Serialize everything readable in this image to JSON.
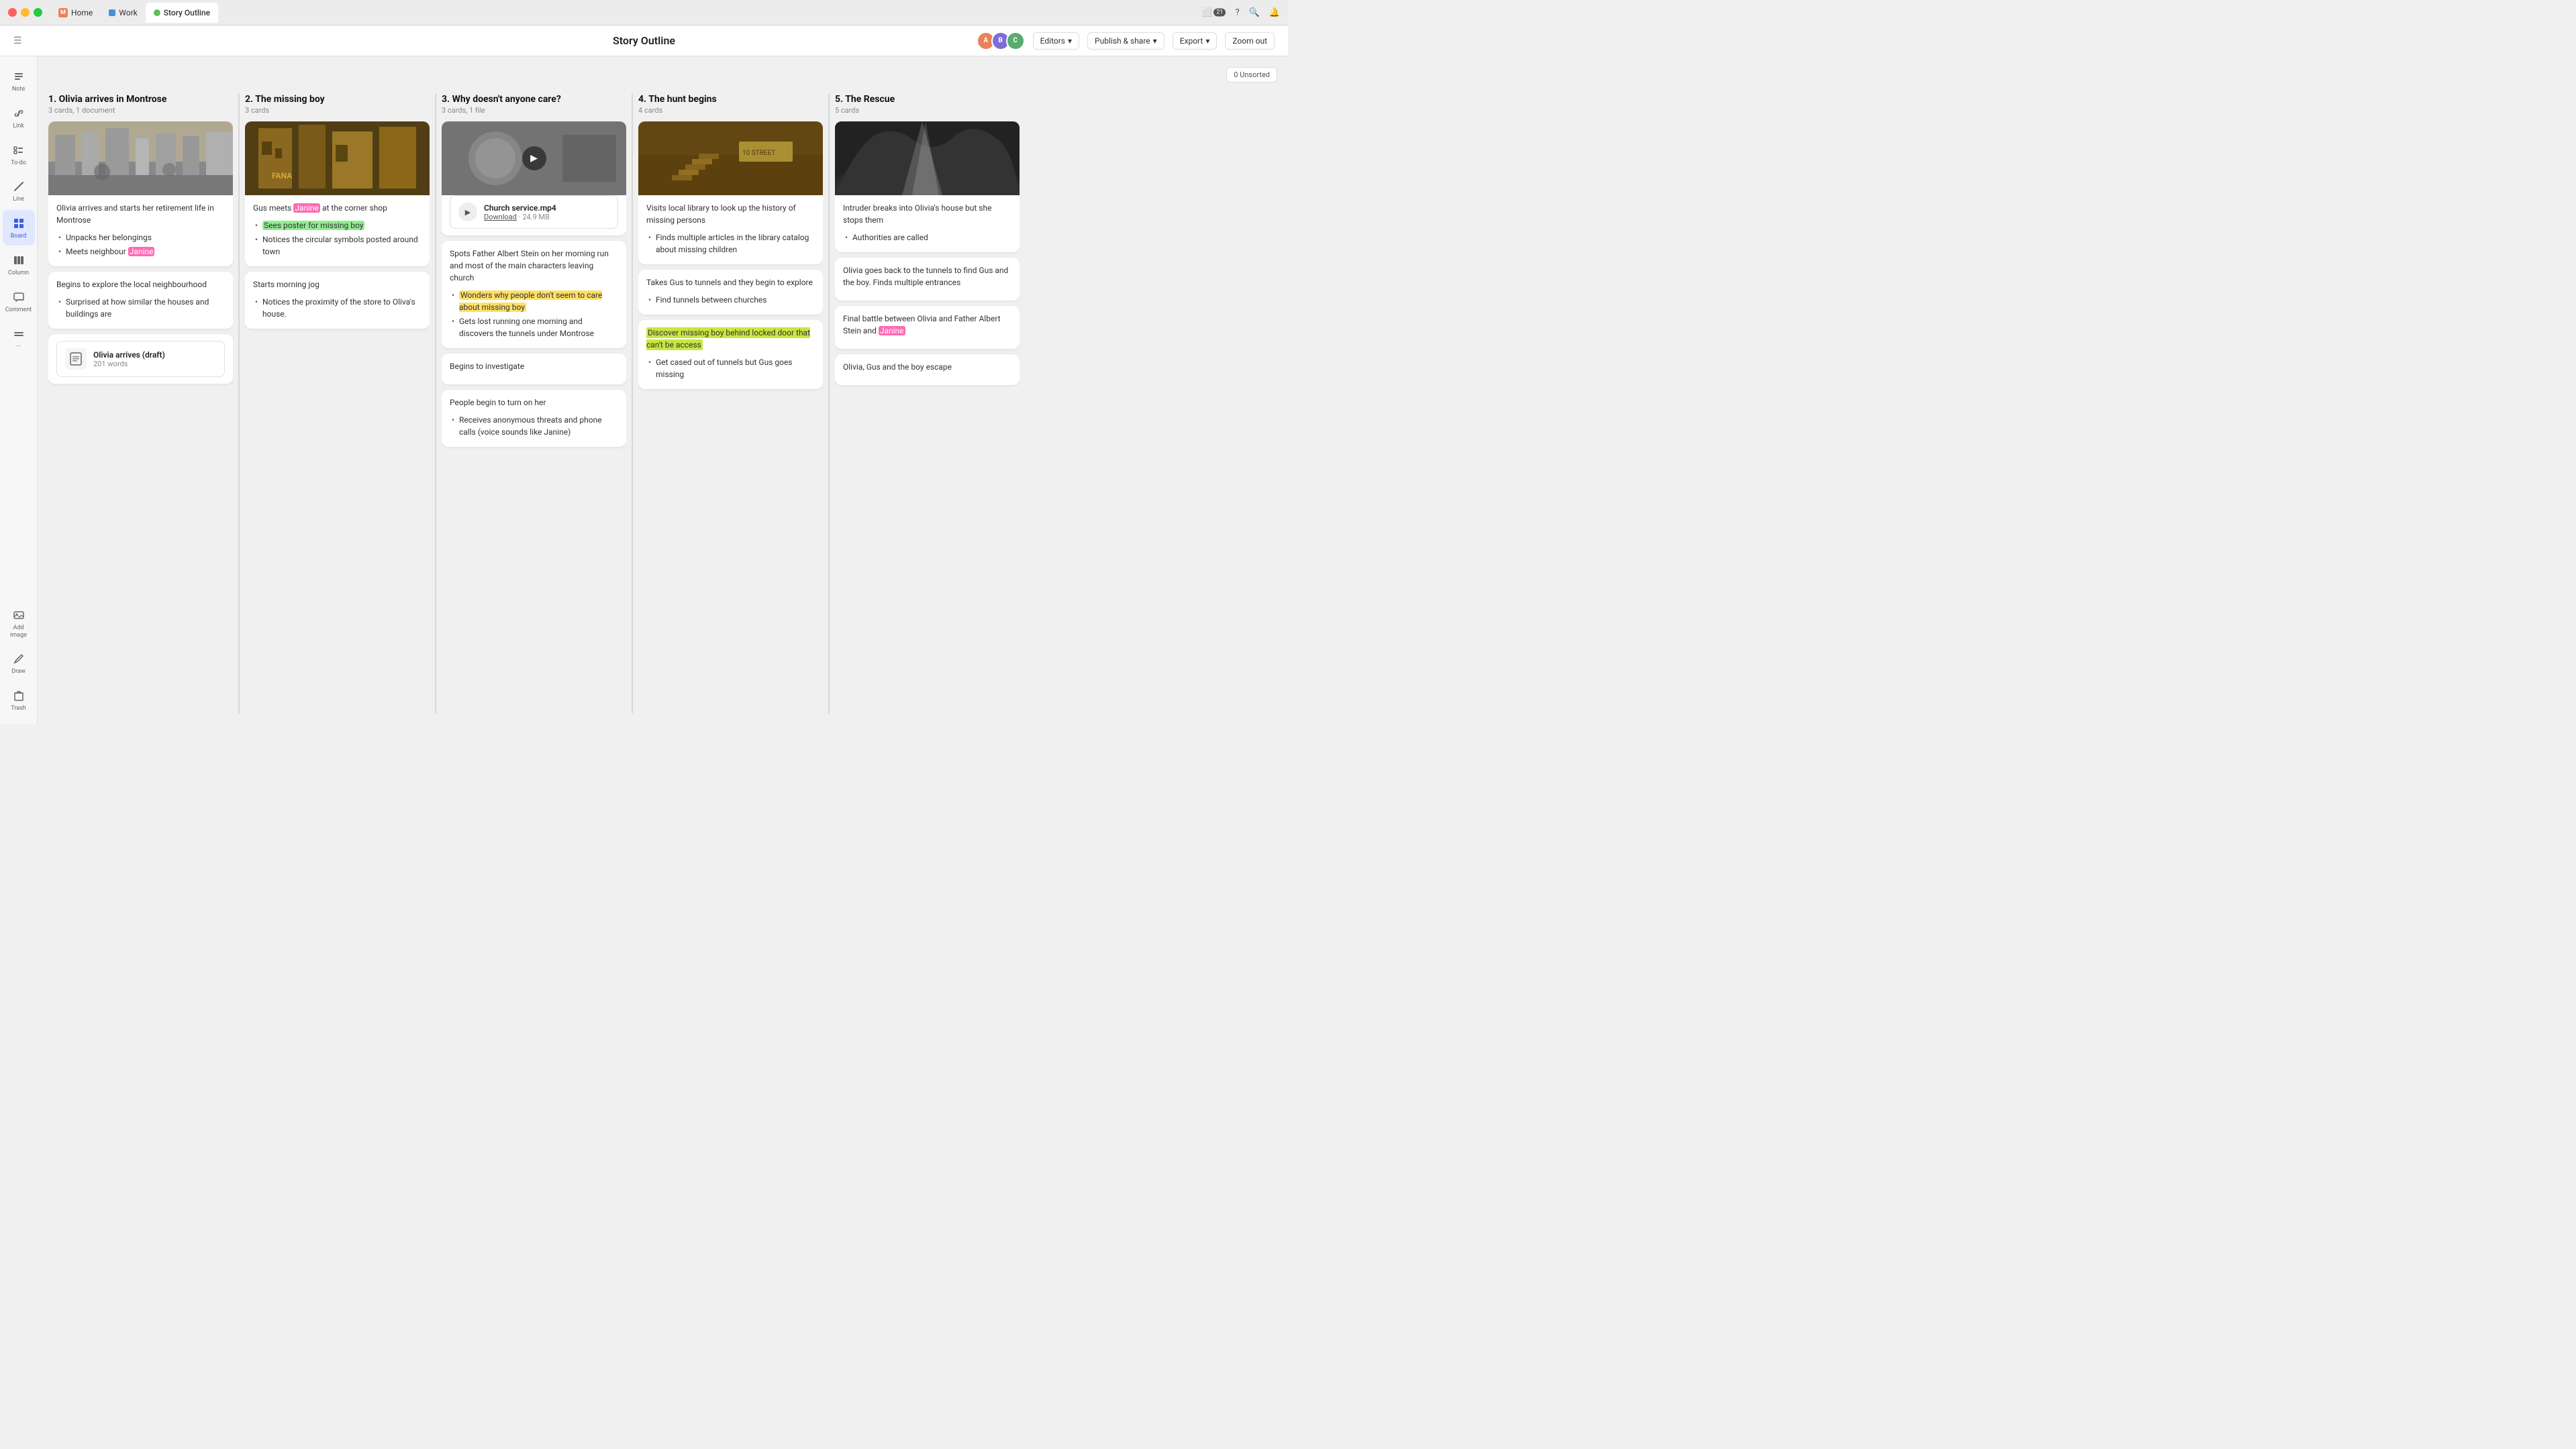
{
  "titlebar": {
    "tabs": [
      {
        "id": "home",
        "label": "Home",
        "icon": "M"
      },
      {
        "id": "work",
        "label": "Work",
        "icon": "W"
      },
      {
        "id": "story-outline",
        "label": "Story Outline",
        "active": true
      }
    ],
    "right_icons": [
      "monitor-icon",
      "help-icon",
      "search-icon",
      "bell-icon"
    ],
    "notif_count": "21"
  },
  "toolbar": {
    "title": "Story Outline",
    "avatars": [
      "A1",
      "A2",
      "A3"
    ],
    "editors_label": "Editors",
    "publish_label": "Publish & share",
    "export_label": "Export",
    "zoomout_label": "Zoom out"
  },
  "sidebar": {
    "items": [
      {
        "id": "note",
        "label": "Note",
        "icon": "☰"
      },
      {
        "id": "link",
        "label": "Link",
        "icon": "⊕"
      },
      {
        "id": "todo",
        "label": "To-do",
        "icon": "≡"
      },
      {
        "id": "line",
        "label": "Line",
        "icon": "/"
      },
      {
        "id": "board",
        "label": "Board",
        "icon": "⊞",
        "active": true
      },
      {
        "id": "column",
        "label": "Column",
        "icon": "▤"
      },
      {
        "id": "comment",
        "label": "Comment",
        "icon": "💬"
      },
      {
        "id": "more",
        "label": "...",
        "icon": "···"
      },
      {
        "id": "add-image",
        "label": "Add image",
        "icon": "🖼"
      },
      {
        "id": "draw",
        "label": "Draw",
        "icon": "✏"
      }
    ],
    "bottom": [
      {
        "id": "trash",
        "label": "Trash",
        "icon": "🗑"
      }
    ]
  },
  "board": {
    "unsorted_label": "0 Unsorted",
    "columns": [
      {
        "id": "col1",
        "title": "1. Olivia arrives in Montrose",
        "subtitle": "3 cards, 1 document",
        "cards": [
          {
            "type": "image-text",
            "image_style": "street",
            "text": "Olivia arrives and starts her retirement life in Montrose",
            "items": [
              "Unpacks her belongings",
              "Meets neighbour [Janine]"
            ]
          },
          {
            "type": "text-list",
            "text": "Begins to explore the local neighbourhood",
            "items": [
              "Surprised at how similar the houses and buildings are"
            ]
          },
          {
            "type": "document",
            "doc_name": "Olivia arrives (draft)",
            "doc_words": "201 words"
          }
        ]
      },
      {
        "id": "col2",
        "title": "2. The missing boy",
        "subtitle": "3 cards",
        "cards": [
          {
            "type": "image-text-list",
            "image_style": "building",
            "intro": "Gus meets [Janine] at the corner shop",
            "items": [
              "[Sees poster for missing boy]",
              "Notices the circular symbols posted around town"
            ]
          },
          {
            "type": "text-list",
            "text": "Starts morning jog",
            "items": [
              "Notices the proximity of the store to Oliva's house."
            ]
          }
        ]
      },
      {
        "id": "col3",
        "title": "3. Why doesn't anyone care?",
        "subtitle": "3 cards, 1 file",
        "cards": [
          {
            "type": "video-file",
            "image_style": "person",
            "has_play": true,
            "file_name": "Church service.mp4",
            "file_download": "Download",
            "file_size": "24.9 MB"
          },
          {
            "type": "text-list",
            "text": "Spots Father Albert Stein on her morning run and most of the main characters leaving church",
            "items": [
              "[Wonders why people don't seem to care about missing boy]",
              "Gets lost running one morning and discovers the tunnels under Montrose"
            ]
          },
          {
            "type": "text-only",
            "text": "Begins to investigate"
          },
          {
            "type": "text-list",
            "text": "People begin to turn on her",
            "items": [
              "Receives anonymous threats and phone calls (voice sounds like Janine)"
            ]
          }
        ]
      },
      {
        "id": "col4",
        "title": "4. The hunt begins",
        "subtitle": "4 cards",
        "cards": [
          {
            "type": "image-text-list",
            "image_style": "stairs",
            "intro": "Visits local library to look up the history of missing persons",
            "items": [
              "Finds multiple articles in the library catalog about missing children"
            ]
          },
          {
            "type": "text-list",
            "text": "Takes Gus to tunnels and they begin to explore",
            "items": [
              "Find tunnels between churches"
            ]
          },
          {
            "type": "highlight-text",
            "highlight": "Discover missing boy behind locked door that can't be access",
            "items": [
              "Get cased out of tunnels but Gus goes missing"
            ]
          }
        ]
      },
      {
        "id": "col5",
        "title": "5. The Rescue",
        "subtitle": "5 cards",
        "cards": [
          {
            "type": "image-text-list",
            "image_style": "cave",
            "intro": "Intruder breaks into Olivia's house but she stops them",
            "items": [
              "Authorities are called"
            ]
          },
          {
            "type": "text-only-multi",
            "text": "Olivia goes back to the tunnels to find Gus and the boy. Finds multiple entrances"
          },
          {
            "type": "text-only-multi",
            "text": "Final battle between Olivia and Father Albert Stein and [Janine]"
          },
          {
            "type": "text-only-multi",
            "text": "Olivia, Gus and the boy escape"
          }
        ]
      }
    ]
  }
}
